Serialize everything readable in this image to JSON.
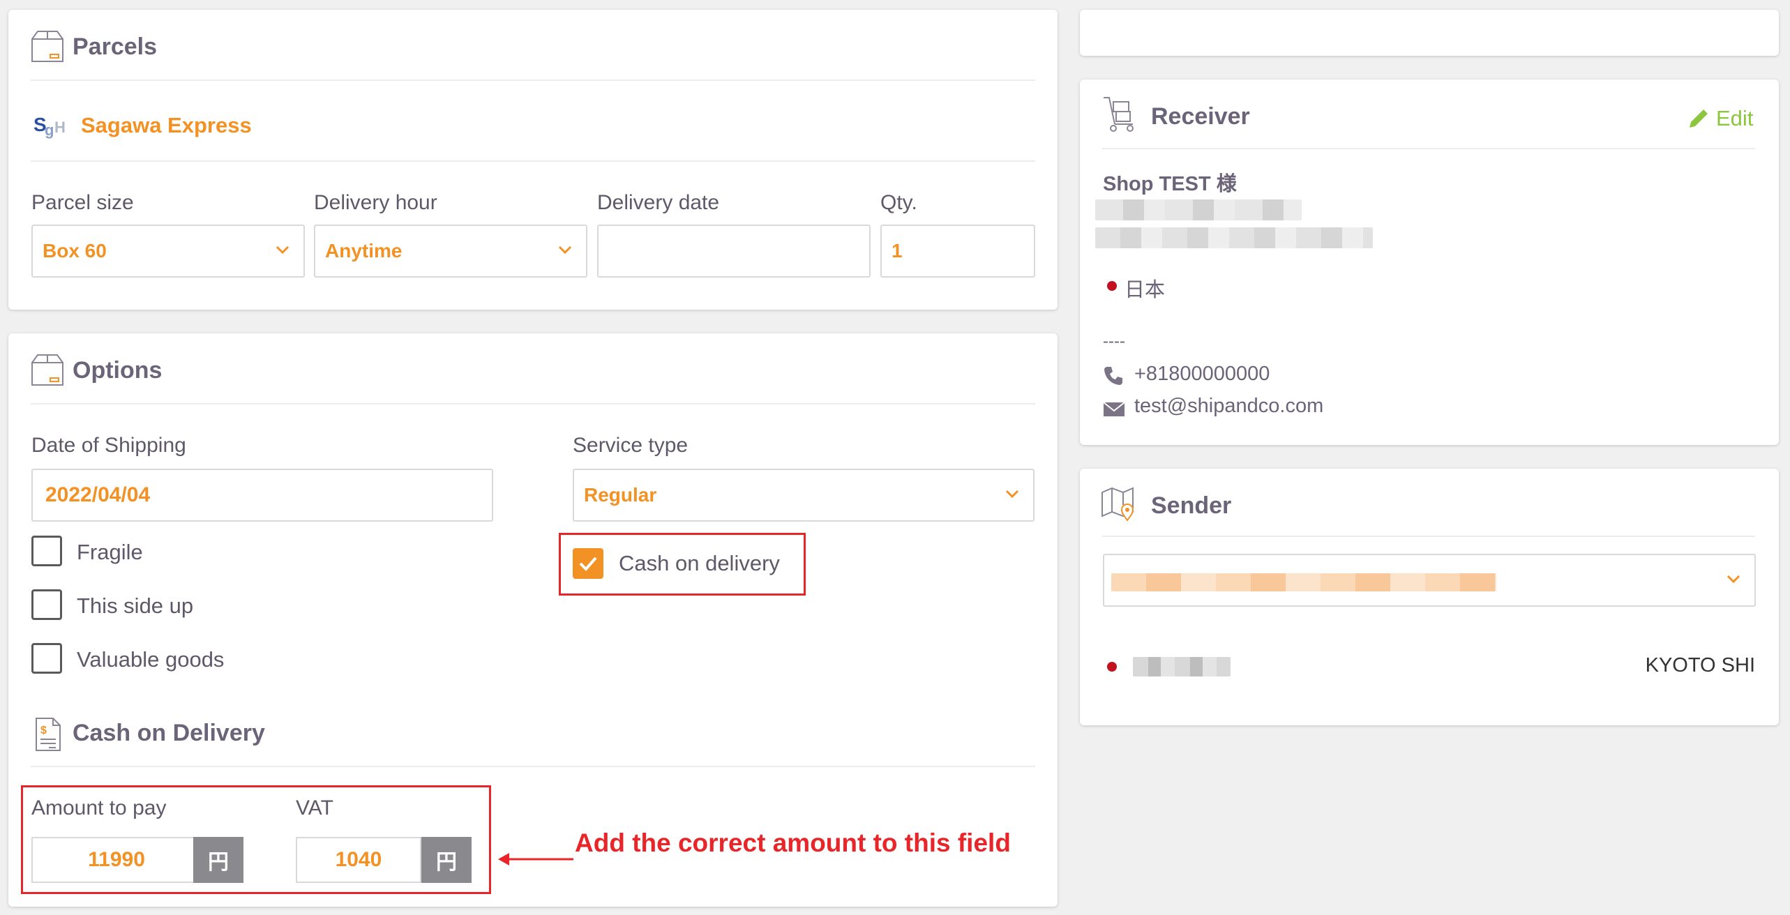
{
  "parcels": {
    "title": "Parcels",
    "carrier": "Sagawa Express",
    "carrier_logo": "SGH",
    "parcel_size_label": "Parcel size",
    "parcel_size_value": "Box 60",
    "delivery_hour_label": "Delivery hour",
    "delivery_hour_value": "Anytime",
    "delivery_date_label": "Delivery date",
    "delivery_date_value": "",
    "qty_label": "Qty.",
    "qty_value": "1"
  },
  "options": {
    "title": "Options",
    "date_of_shipping_label": "Date of Shipping",
    "date_of_shipping_value": "2022/04/04",
    "service_type_label": "Service type",
    "service_type_value": "Regular",
    "checkboxes": [
      {
        "label": "Fragile",
        "checked": false
      },
      {
        "label": "This side up",
        "checked": false
      },
      {
        "label": "Valuable goods",
        "checked": false
      },
      {
        "label": "Cash on delivery",
        "checked": true
      }
    ]
  },
  "cod": {
    "title": "Cash on Delivery",
    "amount_label": "Amount to pay",
    "amount_value": "11990",
    "vat_label": "VAT",
    "vat_value": "1040",
    "currency": "円",
    "annotation": "Add the correct amount to this field"
  },
  "receiver": {
    "title": "Receiver",
    "edit_label": "Edit",
    "name": "Shop TEST 様",
    "country": "日本",
    "dashes": "----",
    "phone": "+81800000000",
    "email": "test@shipandco.com"
  },
  "sender": {
    "title": "Sender",
    "city": "KYOTO SHI"
  },
  "colors": {
    "accent": "#f39224",
    "annotation_red": "#e8262a",
    "edit_green": "#8cc63f",
    "text": "#6b6478"
  }
}
